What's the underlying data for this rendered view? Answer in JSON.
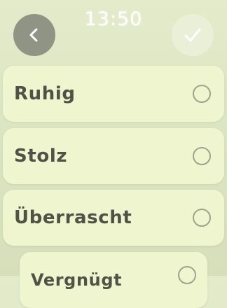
{
  "status_bar": {
    "time": "13:50"
  },
  "navigation": {
    "back_icon": "chevron-left-icon",
    "confirm_icon": "checkmark-icon"
  },
  "options": [
    {
      "label": "Ruhig",
      "selected": false
    },
    {
      "label": "Stolz",
      "selected": false
    },
    {
      "label": "Überrascht",
      "selected": false
    },
    {
      "label": "Vergnügt",
      "selected": false
    }
  ],
  "colors": {
    "background": "#dde6c3",
    "option_background": "#eff5cf",
    "text": "#4f5245",
    "back_button": "#8f9485",
    "radio_border": "#9fa38d"
  }
}
